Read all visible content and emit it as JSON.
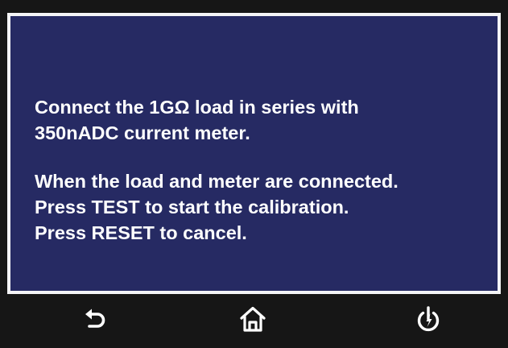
{
  "message": {
    "paragraph1": [
      "Connect the 1GΩ load in series with",
      "350nADC current meter."
    ],
    "paragraph2": [
      "When the load and meter are connected.",
      "Press TEST to start the calibration.",
      "Press RESET to cancel."
    ]
  },
  "toolbar": {
    "buttons": [
      {
        "icon": "back-arrow-icon"
      },
      {
        "icon": "home-icon"
      },
      {
        "icon": "power-icon"
      }
    ]
  },
  "colors": {
    "screen_background": "#262a63",
    "screen_border": "#f4f4f6",
    "bezel": "#161616",
    "text": "#ffffff",
    "icon": "#ffffff"
  }
}
